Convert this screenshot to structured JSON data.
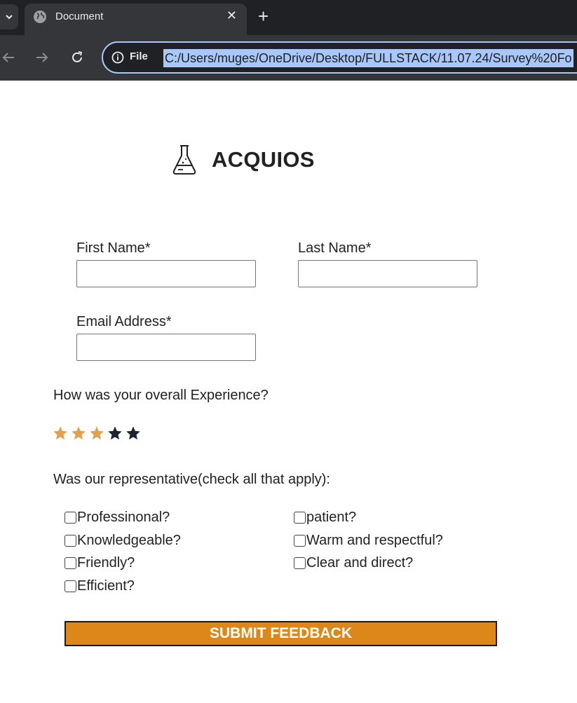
{
  "browser": {
    "tab_title": "Document",
    "new_tab": "+",
    "close": "✕",
    "file_chip": "File",
    "url": "C:/Users/muges/OneDrive/Desktop/FULLSTACK/11.07.24/Survey%20Fo"
  },
  "brand": {
    "title": "ACQUIOS"
  },
  "form": {
    "first_name_label": "First Name*",
    "last_name_label": "Last Name*",
    "email_label": "Email Address*",
    "first_name_value": "",
    "last_name_value": "",
    "email_value": ""
  },
  "experience": {
    "question": "How was your overall Experience?",
    "rating": 3,
    "max": 5,
    "filled_color": "#e0a24e",
    "empty_color": "#1c2430"
  },
  "representative": {
    "question": "Was our representative(check all that apply):",
    "left": [
      "Professinonal?",
      "Knowledgeable?",
      "Friendly?",
      "Efficient?"
    ],
    "right": [
      "patient?",
      "Warm and respectful?",
      "Clear and direct?"
    ]
  },
  "submit_label": "SUBMIT FEEDBACK",
  "colors": {
    "accent": "#dc8719",
    "url_highlight": "#a8c7fa"
  }
}
